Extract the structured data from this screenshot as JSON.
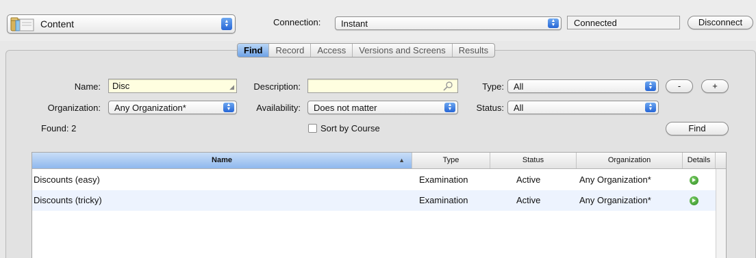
{
  "toolbar": {
    "content_label": "Content",
    "connection_label": "Connection:",
    "connection_value": "Instant",
    "connection_status": "Connected",
    "disconnect_label": "Disconnect"
  },
  "tabs": [
    {
      "label": "Find",
      "active": true
    },
    {
      "label": "Record",
      "active": false
    },
    {
      "label": "Access",
      "active": false
    },
    {
      "label": "Versions and Screens",
      "active": false
    },
    {
      "label": "Results",
      "active": false
    }
  ],
  "form": {
    "name_label": "Name:",
    "name_value": "Disc",
    "description_label": "Description:",
    "description_value": "",
    "type_label": "Type:",
    "type_value": "All",
    "organization_label": "Organization:",
    "organization_value": "Any Organization*",
    "availability_label": "Availability:",
    "availability_value": "Does not matter",
    "status_label": "Status:",
    "status_value": "All",
    "found_label": "Found: 2",
    "sort_by_course_label": "Sort by Course",
    "sort_by_course_checked": false,
    "remove_label": "-",
    "add_label": "+",
    "find_label": "Find"
  },
  "table": {
    "columns": [
      "Name",
      "Type",
      "Status",
      "Organization",
      "Details"
    ],
    "sorted_column": "Name",
    "rows": [
      {
        "name": "Discounts (easy)",
        "type": "Examination",
        "status": "Active",
        "organization": "Any Organization*"
      },
      {
        "name": "Discounts (tricky)",
        "type": "Examination",
        "status": "Active",
        "organization": "Any Organization*"
      }
    ]
  },
  "colors": {
    "accent": "#3a78d8",
    "field_highlight": "#fffee0",
    "details_icon": "#2b8a1e"
  },
  "icons": {
    "content": "folder-icon",
    "stepper": "up-down-arrows-icon",
    "search": "magnifier-icon",
    "details": "go-arrow-icon",
    "sort": "sort-ascending-icon"
  }
}
